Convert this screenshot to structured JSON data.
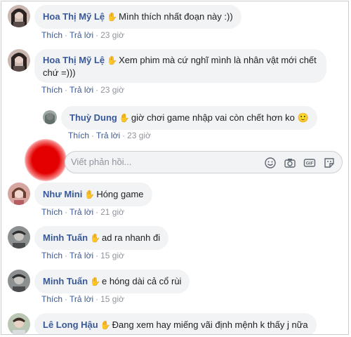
{
  "comments": [
    {
      "author": "Hoa Thị Mỹ Lệ",
      "text": "Mình thích nhất đoạn này :))",
      "like": "Thích",
      "reply": "Trả lời",
      "time": "23 giờ"
    },
    {
      "author": "Hoa Thị Mỹ Lệ",
      "text": "Xem phim mà cứ nghĩ mình là nhân vật mới chết chứ =)))",
      "like": "Thích",
      "reply": "Trả lời",
      "time": "23 giờ"
    },
    {
      "author": "Thuỳ Dung",
      "text": "giờ chơi game nhập vai còn chết hơn ko 🙂",
      "like": "Thích",
      "reply": "Trả lời",
      "time": "23 giờ"
    },
    {
      "author": "Như Mini",
      "text": "Hóng game",
      "like": "Thích",
      "reply": "Trả lời",
      "time": "21 giờ"
    },
    {
      "author": "Minh Tuấn",
      "text": "ad ra nhanh đi",
      "like": "Thích",
      "reply": "Trả lời",
      "time": "15 giờ"
    },
    {
      "author": "Minh Tuấn",
      "text": "e hóng dài cả cổ rùi",
      "like": "Thích",
      "reply": "Trả lời",
      "time": "15 giờ"
    },
    {
      "author": "Lê Long Hậu",
      "text": "Đang xem hay miếng vãi định mệnh k thấy j nữa"
    }
  ],
  "reply_box": {
    "placeholder": "Viết phản hồi..."
  },
  "icons": [
    "emoji-icon",
    "camera-icon",
    "gif-icon",
    "sticker-icon",
    "wave-badge-icon"
  ]
}
